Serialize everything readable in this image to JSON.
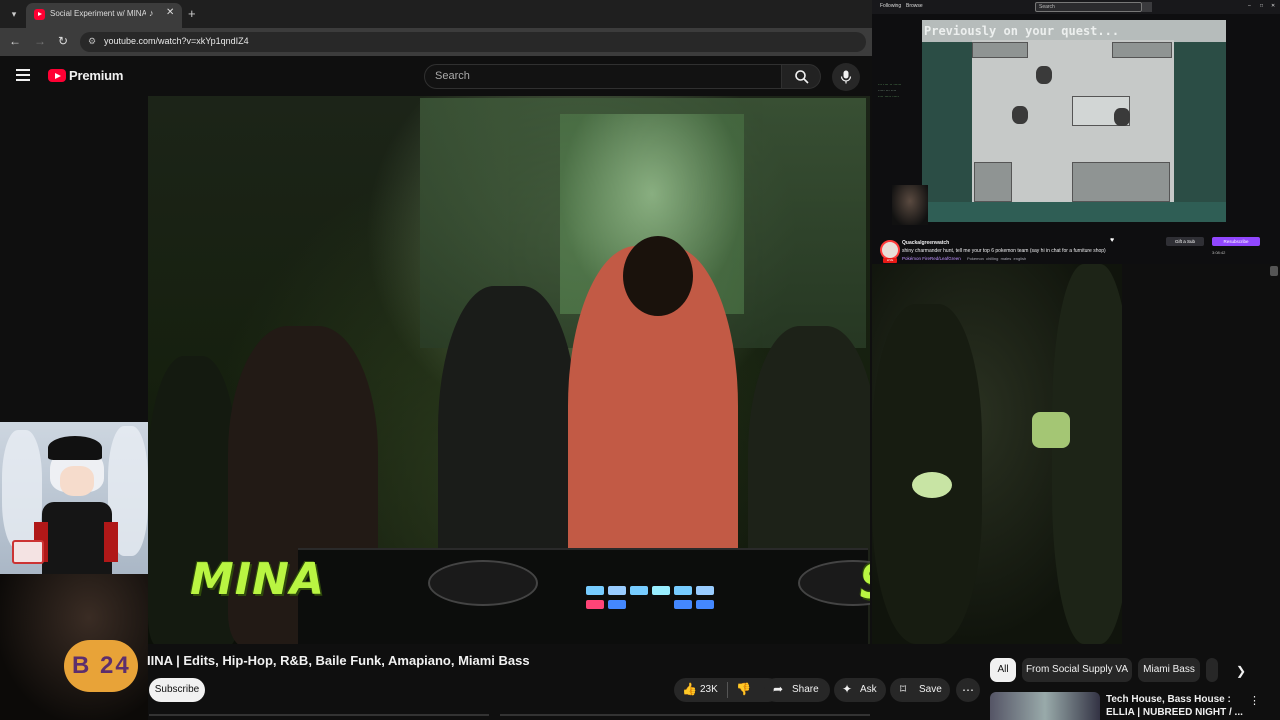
{
  "browser": {
    "tab_title": "Social Experiment w/ MINA",
    "url": "youtube.com/watch?v=xkYp1qndIZ4"
  },
  "youtube": {
    "brand": "Premium",
    "search_placeholder": "Search",
    "video_overlay_left": "MINA",
    "video_overlay_right": "SOCIAL EXPERIMENT",
    "video_title": "IINA | Edits, Hip-Hop, R&B, Baile Funk, Amapiano, Miami Bass",
    "subscribe_label": "Subscribe",
    "like_count": "23K",
    "share_label": "Share",
    "ask_label": "Ask",
    "save_label": "Save",
    "webcam_badge": "B 24",
    "chips": [
      "All",
      "From Social Supply VA",
      "Miami Bass"
    ],
    "rec_title": "Tech House, Bass House : ELLIA | NUBREED NIGHT / ..."
  },
  "stream": {
    "top_menu": [
      "Following",
      "Browse"
    ],
    "search_placeholder": "Search",
    "game_banner": "Previously on your quest...",
    "channel_name": "Quackalgreenwatch",
    "description": "shiny charmander hunt, tell me your top 6 pokemon team (say hi in chat for a furniture shop)",
    "game_category": "Pokémon FireRed/LeafGreen",
    "tags": [
      "Pokemon",
      "chilling",
      "males",
      "english"
    ],
    "live_label": "LIVE",
    "follow_label": "Gift a Sub",
    "subscribe_label": "Resubscribe",
    "meta": "3:08:42"
  },
  "colors": {
    "youtube_red": "#ff0033",
    "overlay_green": "#b9f542",
    "twitch_purple": "#9147ff"
  }
}
